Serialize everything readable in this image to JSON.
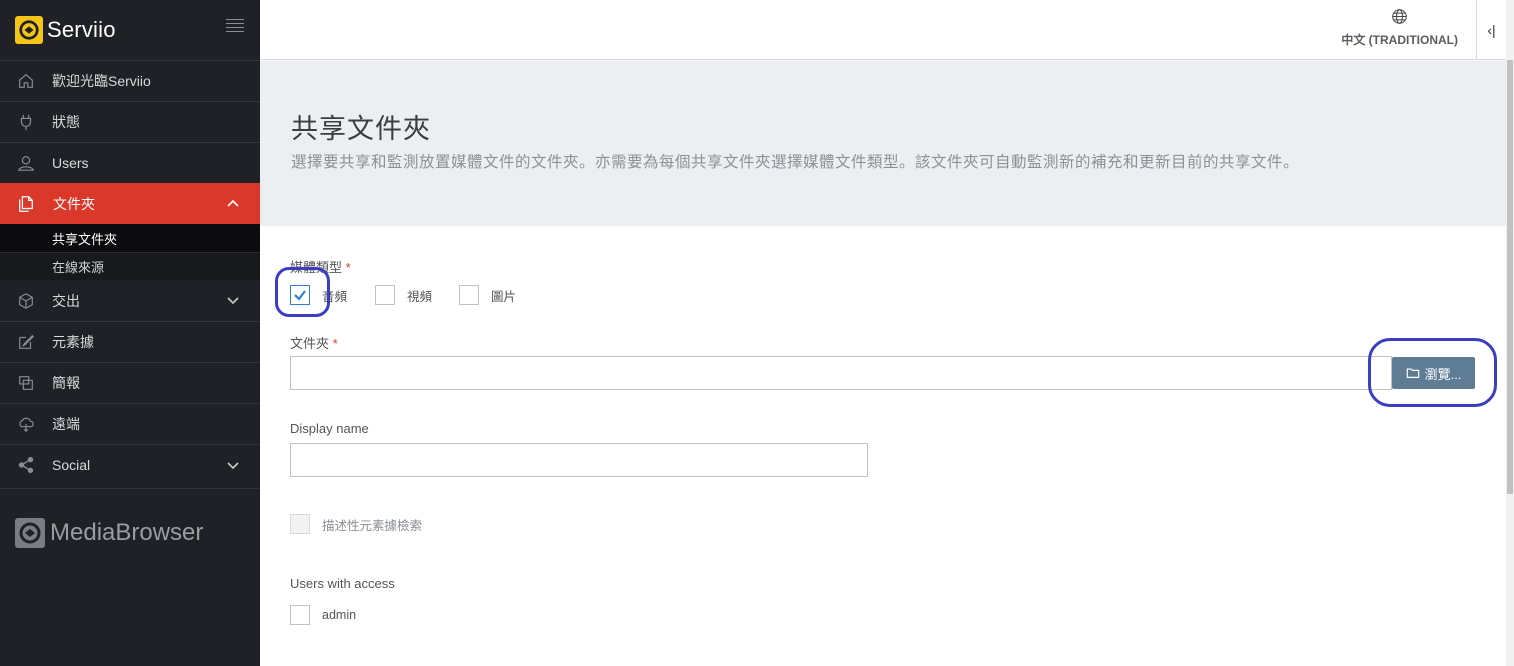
{
  "app": {
    "name": "Serviio"
  },
  "sidebar": {
    "items": [
      {
        "label": "歡迎光臨Serviio",
        "icon": "home-icon"
      },
      {
        "label": "狀態",
        "icon": "plug-icon"
      },
      {
        "label": "Users",
        "icon": "user-icon"
      },
      {
        "label": "文件夾",
        "icon": "files-icon",
        "active": true
      },
      {
        "label": "交出",
        "icon": "cube-icon"
      },
      {
        "label": "元素據",
        "icon": "edit-icon"
      },
      {
        "label": "簡報",
        "icon": "presentation-icon"
      },
      {
        "label": "遠端",
        "icon": "cloud-icon"
      },
      {
        "label": "Social",
        "icon": "share-icon"
      }
    ],
    "subitems": [
      {
        "label": "共享文件夾",
        "current": true
      },
      {
        "label": "在線來源"
      }
    ],
    "mediabrowser": "MediaBrowser"
  },
  "header": {
    "language": "中文 (TRADITIONAL)",
    "collapse_glyph": "‹|"
  },
  "page": {
    "title": "共享文件夾",
    "description": "選擇要共享和監測放置媒體文件的文件夾。亦需要為每個共享文件夾選擇媒體文件類型。該文件夾可自動監測新的補充和更新目前的共享文件。"
  },
  "form": {
    "media_type_label": "媒體類型",
    "required_mark": "*",
    "media_types": [
      {
        "label": "音頻",
        "checked": true
      },
      {
        "label": "視頻",
        "checked": false
      },
      {
        "label": "圖片",
        "checked": false
      }
    ],
    "folder_label": "文件夾",
    "folder_value": "",
    "browse_label": "瀏覽...",
    "display_name_label": "Display name",
    "display_name_value": "",
    "descriptive_metadata_label": "描述性元素據檢索",
    "users_access_label": "Users with access",
    "users": [
      {
        "label": "admin",
        "checked": false
      }
    ]
  },
  "colors": {
    "sidebar_bg": "#1f2126",
    "active_red": "#d9382b",
    "brand_yellow": "#f5c518",
    "button_blue": "#5e7d95",
    "highlight_ring": "#3a3ec0"
  }
}
